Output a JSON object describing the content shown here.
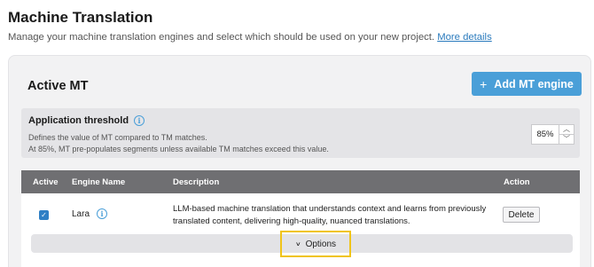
{
  "page": {
    "title": "Machine Translation",
    "subtitle": "Manage your machine translation engines and select which should be used on your new project.",
    "more_link": "More details"
  },
  "active_mt": {
    "title": "Active MT",
    "add_button": "Add MT engine",
    "add_icon": "plus-icon"
  },
  "threshold": {
    "title": "Application threshold",
    "info_icon": "info-icon",
    "desc_line1": "Defines the value of MT compared to TM matches.",
    "desc_line2": "At 85%, MT pre-populates segments unless available TM matches exceed this value.",
    "value": "85%"
  },
  "table": {
    "headers": {
      "active": "Active",
      "engine": "Engine Name",
      "description": "Description",
      "action": "Action"
    },
    "rows": [
      {
        "active": true,
        "engine": "Lara",
        "description": "LLM-based machine translation that understands context and learns from previously translated content, delivering high-quality, nuanced translations.",
        "action": "Delete"
      }
    ]
  },
  "options": {
    "label": "Options",
    "icon": "chevron-down-icon",
    "highlight_color": "#f0c419"
  },
  "colors": {
    "accent": "#4a9fd8",
    "table_header": "#6f6f72",
    "link": "#2b7bbd"
  }
}
